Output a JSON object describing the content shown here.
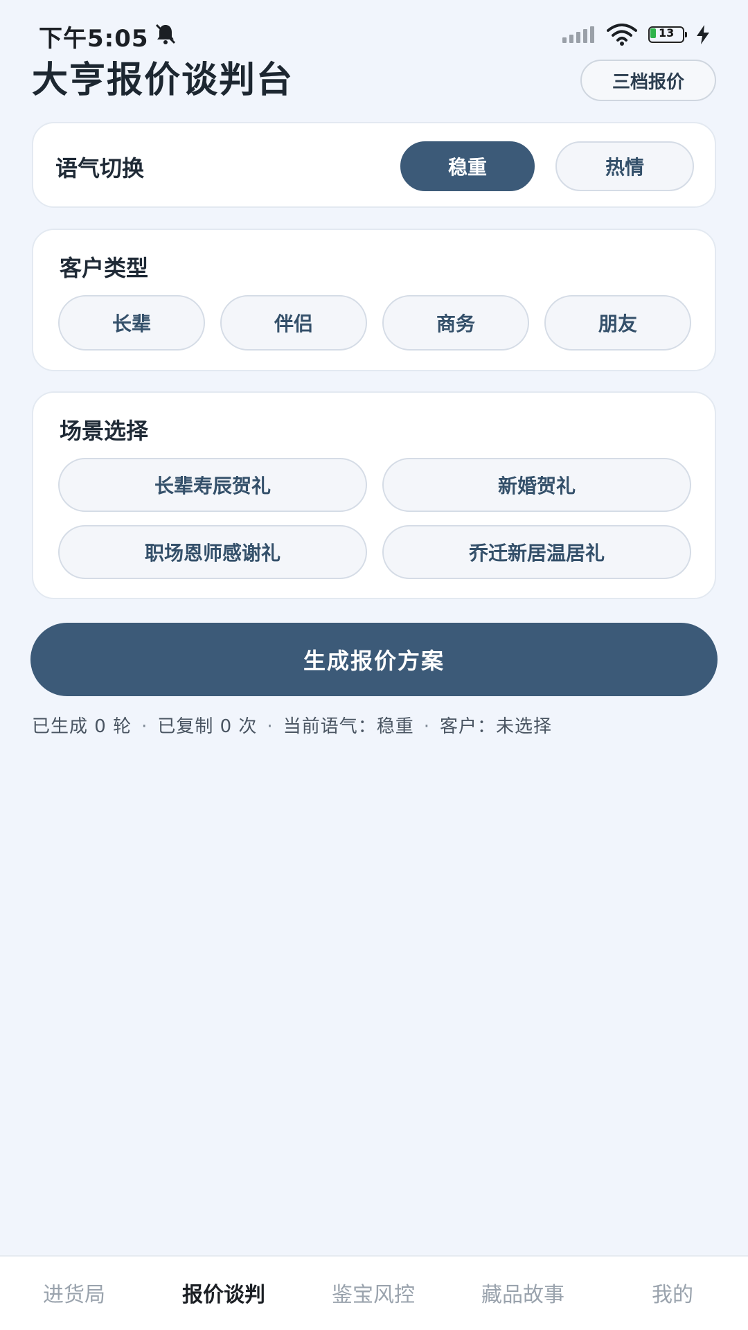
{
  "status_bar": {
    "time": "下午5:05",
    "battery_level": "13"
  },
  "header": {
    "title": "大亨报价谈判台",
    "action_button": "三档报价"
  },
  "tone": {
    "label": "语气切换",
    "options": [
      "稳重",
      "热情"
    ],
    "selected": "稳重"
  },
  "customer": {
    "label": "客户类型",
    "options": [
      "长辈",
      "伴侣",
      "商务",
      "朋友"
    ]
  },
  "scene": {
    "label": "场景选择",
    "options": [
      "长辈寿辰贺礼",
      "新婚贺礼",
      "职场恩师感谢礼",
      "乔迁新居温居礼"
    ]
  },
  "generate_button": "生成报价方案",
  "stats": {
    "generated": "已生成 0 轮",
    "copied": "已复制 0 次",
    "current_tone": "当前语气：稳重",
    "customer": "客户：未选择",
    "separator": "·"
  },
  "bottom_nav": {
    "items": [
      "进货局",
      "报价谈判",
      "鉴宝风控",
      "藏品故事",
      "我的"
    ],
    "active": "报价谈判"
  },
  "colors": {
    "accent": "#3c5a78",
    "background": "#f1f5fc",
    "card": "#ffffff"
  }
}
